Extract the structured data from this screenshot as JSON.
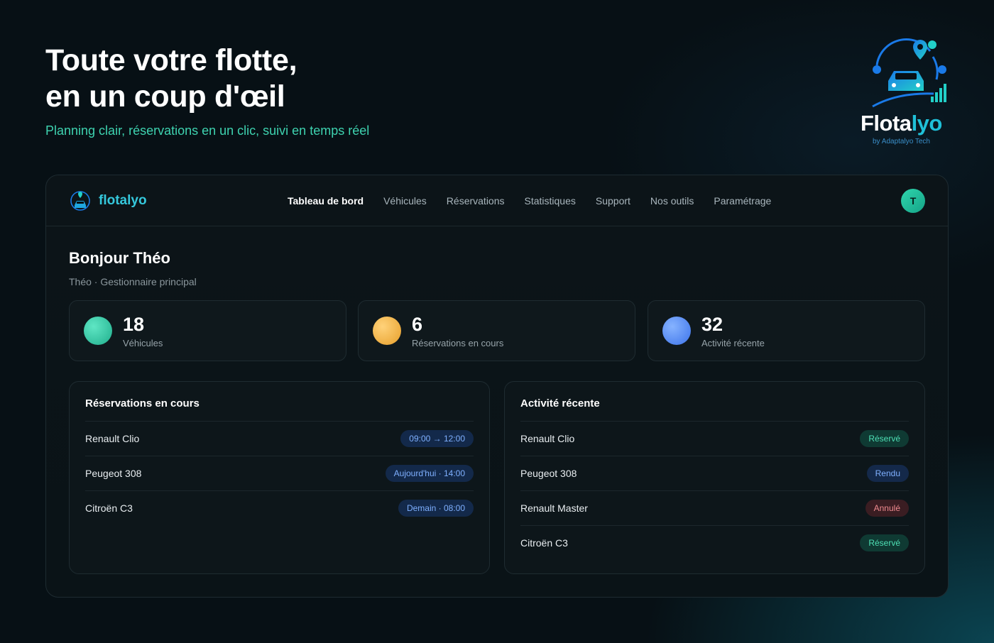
{
  "hero": {
    "title_line1": "Toute votre flotte,",
    "title_line2": "en un coup d'œil",
    "subtitle": "Planning clair, réservations en un clic, suivi en temps réel"
  },
  "brand": {
    "name_part1": "Flota",
    "name_part2": "lyo",
    "byline": "by Adaptalyo Tech"
  },
  "nav": {
    "logo_text": "flotalyo",
    "items": [
      {
        "label": "Tableau de bord",
        "active": true
      },
      {
        "label": "Véhicules"
      },
      {
        "label": "Réservations"
      },
      {
        "label": "Statistiques"
      },
      {
        "label": "Support"
      },
      {
        "label": "Nos outils"
      },
      {
        "label": "Paramétrage"
      }
    ],
    "avatar_initial": "T"
  },
  "greeting": {
    "title": "Bonjour Théo",
    "subtitle": "Théo · Gestionnaire principal"
  },
  "stats": [
    {
      "value": "18",
      "label": "Véhicules",
      "color": "#2fc9a4"
    },
    {
      "value": "6",
      "label": "Réservations en cours",
      "color": "#f2b446"
    },
    {
      "value": "32",
      "label": "Activité récente",
      "color": "#4f8cf7"
    }
  ],
  "reservations": {
    "title": "Réservations en cours",
    "rows": [
      {
        "name": "Renault Clio",
        "time": "09:00 → 12:00"
      },
      {
        "name": "Peugeot 308",
        "time": "Aujourd'hui · 14:00"
      },
      {
        "name": "Citroën C3",
        "time": "Demain · 08:00"
      }
    ]
  },
  "activity": {
    "title": "Activité récente",
    "rows": [
      {
        "name": "Renault Clio",
        "status": "Réservé"
      },
      {
        "name": "Peugeot 308",
        "status": "Rendu"
      },
      {
        "name": "Renault Master",
        "status": "Annulé"
      },
      {
        "name": "Citroën C3",
        "status": "Réservé"
      }
    ]
  }
}
